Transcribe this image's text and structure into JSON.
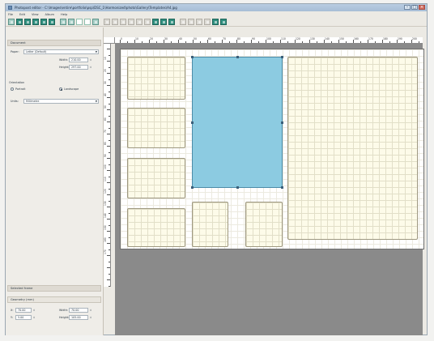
{
  "window": {
    "title": "Photopost editor - C:\\Images\\entire\\portfolio\\psp\\DSC_1\\Harmonized\\photo\\Gallery\\Templates\\A4.jpg",
    "minimize": "–",
    "maximize": "□",
    "close": "×"
  },
  "menubar": [
    "File",
    "Edit",
    "View",
    "Album",
    "Help"
  ],
  "toolbar": {
    "groups": [
      {
        "buttons": [
          {
            "name": "new-tool-button",
            "style": "teal"
          },
          {
            "name": "open-tool-button",
            "style": "green"
          },
          {
            "name": "save-tool-button",
            "style": "green"
          },
          {
            "name": "save-as-tool-button",
            "style": "green"
          },
          {
            "name": "print-tool-button",
            "style": "green"
          },
          {
            "name": "export-tool-button",
            "style": "green"
          }
        ]
      },
      {
        "buttons": [
          {
            "name": "frame-tool-button",
            "style": "teal"
          },
          {
            "name": "shape-tool-button",
            "style": "teal"
          },
          {
            "name": "select-tool-button",
            "style": "outline"
          },
          {
            "name": "crop-tool-button",
            "style": "outline"
          },
          {
            "name": "zoom-tool-button",
            "style": "teal"
          }
        ]
      },
      {
        "buttons": [
          {
            "name": "align-left-tool-button",
            "style": "dim"
          },
          {
            "name": "align-center-tool-button",
            "style": "dim"
          },
          {
            "name": "align-right-tool-button",
            "style": "dim"
          },
          {
            "name": "align-top-tool-button",
            "style": "dim"
          },
          {
            "name": "align-middle-tool-button",
            "style": "dim"
          },
          {
            "name": "align-bottom-tool-button",
            "style": "dim"
          },
          {
            "name": "distribute-h-tool-button",
            "style": "green"
          },
          {
            "name": "distribute-v-tool-button",
            "style": "green"
          },
          {
            "name": "group-tool-button",
            "style": "green"
          }
        ]
      },
      {
        "buttons": [
          {
            "name": "lock-tool-button",
            "style": "dim"
          },
          {
            "name": "unlock-tool-button",
            "style": "dim"
          },
          {
            "name": "bring-front-tool-button",
            "style": "dim"
          },
          {
            "name": "send-back-tool-button",
            "style": "dim"
          },
          {
            "name": "grid-tool-button",
            "style": "green"
          },
          {
            "name": "snap-tool-button",
            "style": "green"
          }
        ]
      }
    ]
  },
  "left_panel": {
    "document_section": "Document",
    "paper_label": "Paper:",
    "paper_value": "Letter (Default)",
    "width_label": "Width:",
    "width_value": "210.00",
    "height_label": "Height:",
    "height_value": "297.00",
    "orientation_section": "Orientation",
    "portrait_label": "Portrait",
    "landscape_label": "Landscape",
    "units_label": "Units:",
    "units_value": "Millimetre",
    "selected_section": "Selected frame",
    "geometry_section": "Geometry (mm)",
    "x_label": "X:",
    "x_value": "70.00",
    "y_label": "Y:",
    "y_value": "5.00",
    "frame_width_label": "Width:",
    "frame_width_value": "70.00",
    "frame_height_label": "Height:",
    "frame_height_value": "105.00"
  },
  "ruler_top_labels": [
    "0",
    "10",
    "20",
    "30",
    "40",
    "50",
    "60",
    "70",
    "80",
    "90",
    "100",
    "110",
    "120",
    "130",
    "140",
    "150",
    "160",
    "170",
    "180",
    "190",
    "200"
  ],
  "ruler_left_labels": [
    "10",
    "20",
    "30",
    "40",
    "50",
    "60",
    "70",
    "80",
    "90",
    "100",
    "110",
    "120",
    "130",
    "140",
    "150",
    "160",
    "170"
  ],
  "colors": {
    "selected_frame": "#8ccbe1",
    "frame_fill": "#fdfbe9",
    "workspace": "#8a8a8a"
  }
}
